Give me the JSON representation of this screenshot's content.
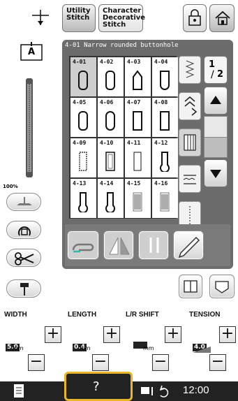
{
  "topbar": {
    "tab_utility_line1": "Utility",
    "tab_utility_line2": "Stitch",
    "tab_character_line1": "Character",
    "tab_character_line2": "Decorative",
    "tab_character_line3": "Stitch"
  },
  "left": {
    "presser_foot_label": "A",
    "zoom_label": "100%"
  },
  "panel": {
    "header": "4-01  Narrow rounded buttonhole",
    "page_indicator_top": "1",
    "page_indicator_bottom": "2",
    "stitches": [
      {
        "code": "4-01",
        "icon": "buttonhole-round-end-icon",
        "selected": true
      },
      {
        "code": "4-02",
        "icon": "buttonhole-round-end-icon"
      },
      {
        "code": "4-03",
        "icon": "buttonhole-pointed-icon"
      },
      {
        "code": "4-04",
        "icon": "buttonhole-square-top-icon"
      },
      {
        "code": "4-05",
        "icon": "buttonhole-round-end-icon"
      },
      {
        "code": "4-06",
        "icon": "buttonhole-round-both-icon"
      },
      {
        "code": "4-07",
        "icon": "buttonhole-square-icon"
      },
      {
        "code": "4-08",
        "icon": "buttonhole-square-icon"
      },
      {
        "code": "4-09",
        "icon": "buttonhole-stretch-icon"
      },
      {
        "code": "4-10",
        "icon": "buttonhole-heirloom-icon"
      },
      {
        "code": "4-11",
        "icon": "buttonhole-bound-icon"
      },
      {
        "code": "4-12",
        "icon": "buttonhole-keyhole-icon"
      },
      {
        "code": "4-13",
        "icon": "buttonhole-keyhole-icon"
      },
      {
        "code": "4-14",
        "icon": "buttonhole-keyhole-icon"
      },
      {
        "code": "4-15",
        "icon": "darning-icon"
      },
      {
        "code": "4-16",
        "icon": "darning-icon"
      }
    ]
  },
  "params": {
    "width_label": "WIDTH",
    "length_label": "LENGTH",
    "shift_label": "L/R SHIFT",
    "tension_label": "TENSION",
    "width_value": "5.0",
    "length_value": "0.4",
    "shift_value": "",
    "tension_value": "4.0",
    "unit": "mm",
    "plus": "+",
    "minus": "−"
  },
  "statusbar": {
    "help_label": "?",
    "time": "12:00"
  },
  "colors": {
    "panel": "#6c6c6c",
    "help_highlight": "#e8b62a",
    "status_bar": "#222222"
  }
}
